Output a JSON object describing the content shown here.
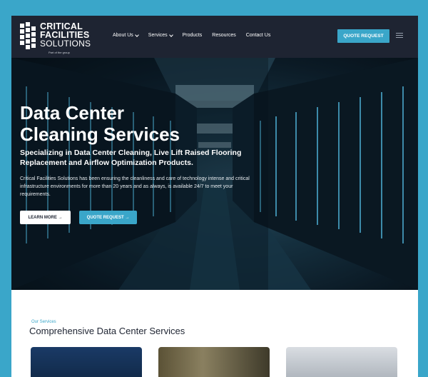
{
  "header": {
    "logo": {
      "line1": "CRITICAL",
      "line2": "FACILITIES",
      "line3": "SOLUTIONS",
      "sub": "Part of the group"
    },
    "nav": [
      {
        "label": "About Us",
        "dropdown": true
      },
      {
        "label": "Services",
        "dropdown": true
      },
      {
        "label": "Products",
        "dropdown": false
      },
      {
        "label": "Resources",
        "dropdown": false
      },
      {
        "label": "Contact Us",
        "dropdown": false
      }
    ],
    "quote_button": "QUOTE REQUEST"
  },
  "hero": {
    "title_line1": "Data Center",
    "title_line2": "Cleaning Services",
    "subtitle": "Specializing in Data Center Cleaning, Live Lift Raised Flooring Replacement and Airflow Optimization Products.",
    "body": "Critical Facilities Solutions has been ensuring the cleanliness and care of technology intense and critical infrastructure environments for more than 20 years and as always, is available 24/7 to meet your requirements.",
    "learn_more": "LEARN MORE →",
    "quote_request": "QUOTE REQUEST →"
  },
  "services": {
    "eyebrow": "Our Services",
    "title": "Comprehensive Data Center Services"
  },
  "colors": {
    "accent": "#3aa6c9",
    "header_bg": "#1e2432",
    "page_bg": "#3aa6c9"
  }
}
